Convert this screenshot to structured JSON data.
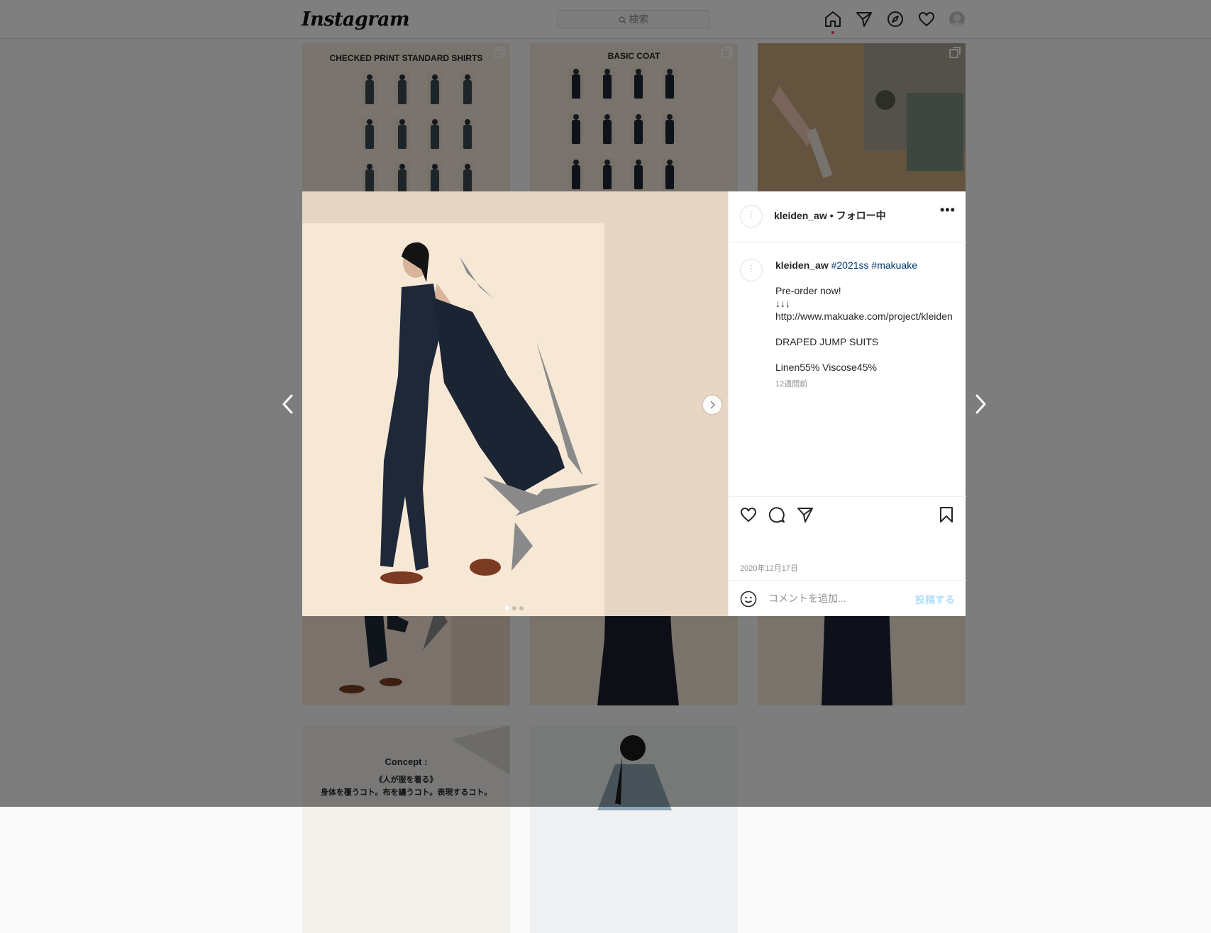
{
  "header": {
    "logo": "Instagram",
    "search_placeholder": "検索",
    "nav_icons": [
      "home-icon",
      "direct-icon",
      "explore-icon",
      "activity-heart-icon",
      "profile-avatar"
    ]
  },
  "grid": {
    "tiles": [
      {
        "title": "CHECKED PRINT STANDARD SHIRTS"
      },
      {
        "title": "BASIC COAT"
      },
      {
        "title": ""
      }
    ],
    "bottom_tile": {
      "title": "Concept :",
      "line1": "《人が服を着る》",
      "line2": "身体を覆うコト。布を纏うコト。表現するコト。"
    }
  },
  "post": {
    "username": "kleiden_aw",
    "separator": "•",
    "follow_status": "フォロー中",
    "more_label": "•••",
    "caption": {
      "username": "kleiden_aw",
      "hashtags": "#2021ss #makuake",
      "line1": "Pre-order now!",
      "line2": "↓↓↓",
      "line3": "http://www.makuake.com/project/kleiden",
      "line4": "DRAPED JUMP SUITS",
      "line5": "Linen55% Viscose45%",
      "time_ago": "12週間前"
    },
    "date": "2020年12月17日",
    "comment_placeholder": "コメントを追加...",
    "post_button": "投稿する",
    "carousel": {
      "total": 3,
      "current": 1
    }
  },
  "colors": {
    "accent_blue": "#00376b",
    "post_button_disabled": "#b2dffc",
    "notification_dot": "#ed4956"
  }
}
